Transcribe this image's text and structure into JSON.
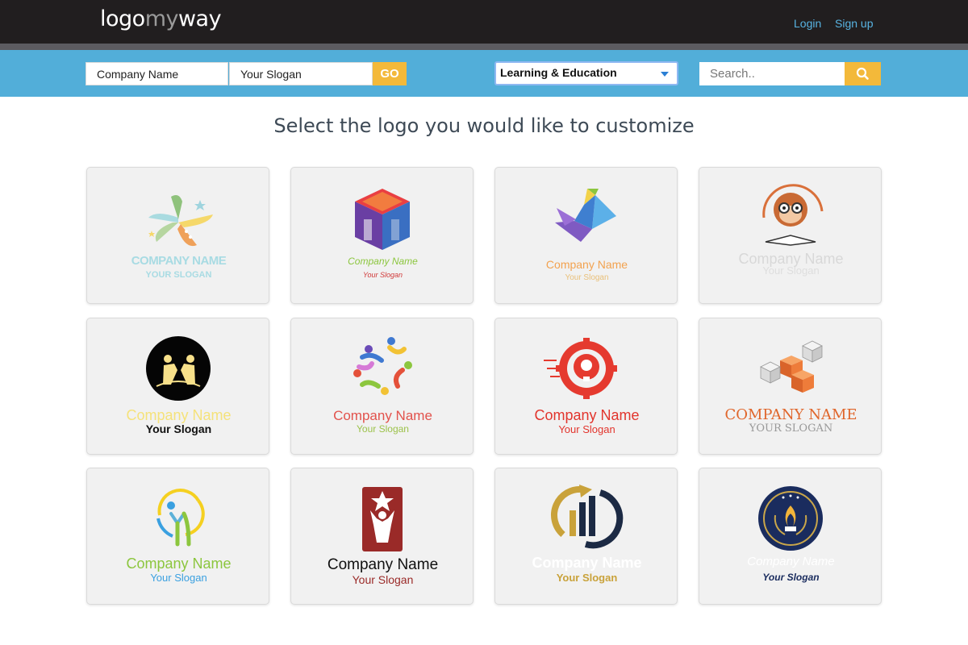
{
  "header": {
    "brand_part1": "logo",
    "brand_part2": "my",
    "brand_part3": "way",
    "login_label": "Login",
    "signup_label": "Sign up"
  },
  "toolbar": {
    "company_value": "Company Name",
    "slogan_value": "Your Slogan",
    "go_label": "GO",
    "category_value": "Learning & Education",
    "search_placeholder": "Search.."
  },
  "main": {
    "heading": "Select the logo you would like to customize"
  },
  "logos": [
    {
      "name": "COMPANY NAME",
      "slogan": "YOUR SLOGAN",
      "icon": "star-leaves-icon"
    },
    {
      "name": "Company Name",
      "slogan": "Your Slogan",
      "icon": "cube-blocks-icon"
    },
    {
      "name": "Company Name",
      "slogan": "Your Slogan",
      "icon": "origami-bird-icon"
    },
    {
      "name": "Company Name",
      "slogan": "Your Slogan",
      "icon": "monkey-reading-icon"
    },
    {
      "name": "Company Name",
      "slogan": "Your Slogan",
      "icon": "teamwork-circle-icon"
    },
    {
      "name": "Company Name",
      "slogan": "Your Slogan",
      "icon": "people-star-icon"
    },
    {
      "name": "Company Name",
      "slogan": "Your Slogan",
      "icon": "lightbulb-gear-icon"
    },
    {
      "name": "COMPANY NAME",
      "slogan": "YOUR SLOGAN",
      "icon": "cubes-cluster-icon"
    },
    {
      "name": "Company Name",
      "slogan": "Your Slogan",
      "icon": "person-arc-icon"
    },
    {
      "name": "Company Name",
      "slogan": "Your Slogan",
      "icon": "star-lifter-icon"
    },
    {
      "name": "Company Name",
      "slogan": "Your Slogan",
      "icon": "arrow-buildings-icon"
    },
    {
      "name": "Company Name",
      "slogan": "Your Slogan",
      "icon": "flame-badge-icon"
    }
  ],
  "colors": {
    "topbar": "#211e1f",
    "searchbar": "#52aed9",
    "accent_yellow": "#f3b93a",
    "link_blue": "#58b4e3"
  }
}
